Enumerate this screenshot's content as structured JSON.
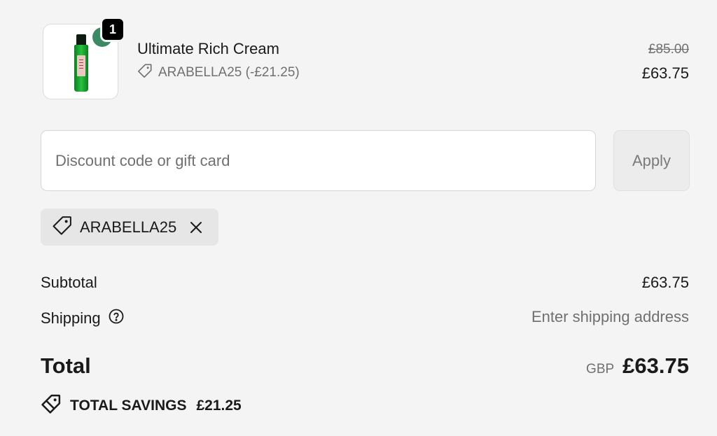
{
  "product": {
    "name": "Ultimate Rich Cream",
    "quantity": "1",
    "discount_line": "ARABELLA25 (-£21.25)",
    "original_price": "£85.00",
    "price": "£63.75",
    "image_icon": "product-bottle-image"
  },
  "discount": {
    "placeholder": "Discount code or gift card",
    "value": "",
    "apply_label": "Apply"
  },
  "applied_code": {
    "label": "ARABELLA25",
    "icon": "tag-icon",
    "remove_icon": "close-icon"
  },
  "summary": {
    "subtotal_label": "Subtotal",
    "subtotal_value": "£63.75",
    "shipping_label": "Shipping",
    "shipping_value": "Enter shipping address",
    "total_label": "Total",
    "currency": "GBP",
    "total_value": "£63.75",
    "savings_label": "TOTAL SAVINGS",
    "savings_value": "£21.25"
  },
  "colors": {
    "background": "#f4f4f4",
    "text": "#1a1a1a",
    "muted": "#707070",
    "badge": "#000000"
  }
}
